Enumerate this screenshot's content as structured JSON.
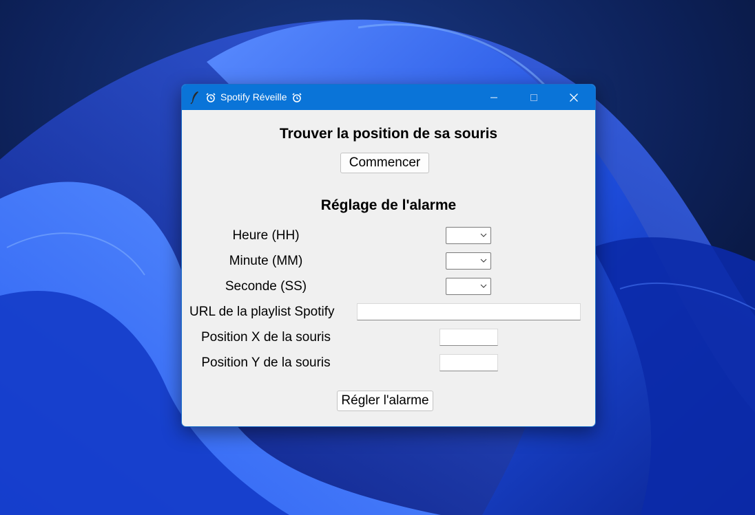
{
  "window": {
    "title": "Spotify Réveille",
    "title_icon_left": "alarm-clock-icon",
    "title_icon_right": "alarm-clock-icon",
    "app_icon": "feather-icon",
    "controls": [
      "minimize-icon",
      "maximize-icon",
      "close-icon"
    ]
  },
  "mouse_section": {
    "heading": "Trouver la position de sa souris",
    "start_button": "Commencer"
  },
  "alarm_section": {
    "heading": "Réglage de l'alarme",
    "hour_label": "Heure (HH)",
    "hour_value": "",
    "minute_label": "Minute (MM)",
    "minute_value": "",
    "second_label": "Seconde (SS)",
    "second_value": "",
    "playlist_label": "URL de la playlist Spotify",
    "playlist_value": "",
    "pos_x_label": "Position X de la souris",
    "pos_x_value": "",
    "pos_y_label": "Position Y de la souris",
    "pos_y_value": "",
    "submit_button": "Régler l'alarme"
  },
  "colors": {
    "titlebar": "#0a74d8",
    "window_bg": "#f0f0f0",
    "wallpaper_dark": "#0b1a4a",
    "wallpaper_blue": "#1f4fe0"
  }
}
